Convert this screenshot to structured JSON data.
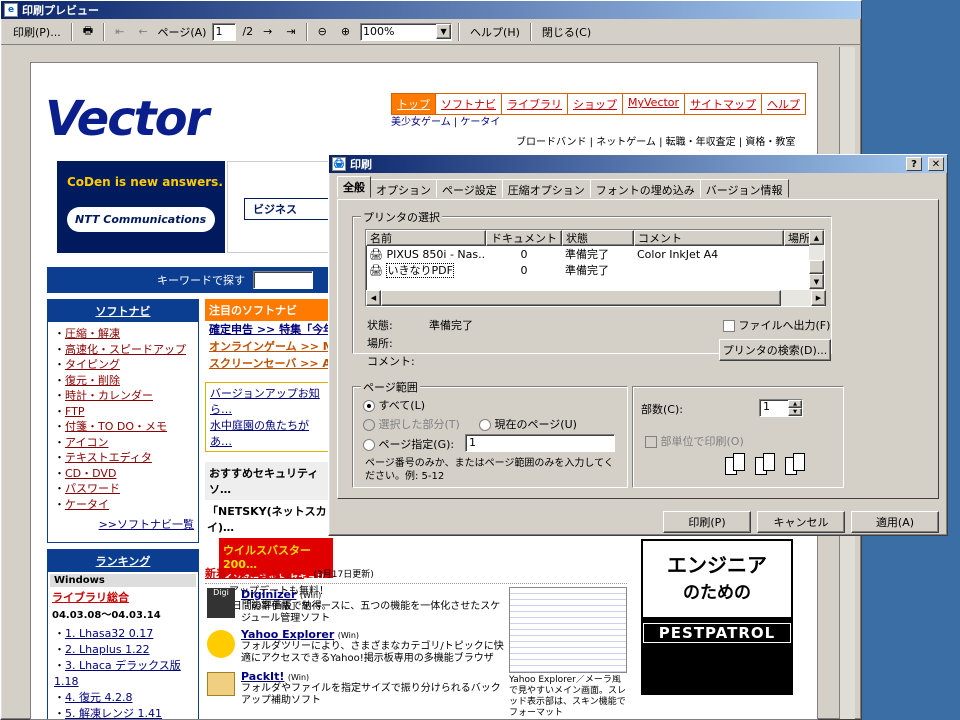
{
  "preview": {
    "title": "印刷プレビュー",
    "toolbar": {
      "print": "印刷(P)...",
      "page_label": "ページ(A)",
      "page_value": "1",
      "page_total": "/2",
      "zoom": "100%",
      "help": "ヘルプ(H)",
      "close": "閉じる(C)"
    }
  },
  "site": {
    "logo": "Vector",
    "nav": [
      "トップ",
      "ソフトナビ",
      "ライブラリ",
      "ショップ",
      "MyVector",
      "サイトマップ",
      "ヘルプ"
    ],
    "subnav": "美少女ゲーム | ケータイ",
    "subnav2": "ブロードバンド | ネットゲーム | 転職・年収査定 | 資格・教室",
    "banner_line1": "CoDen is new answers.",
    "banner_line2": "NTT Communications",
    "biz": "ビジネス",
    "search_label": "キーワードで探す",
    "softnavi": {
      "header": "ソフトナビ",
      "items": [
        "圧縮・解凍",
        "高速化・スピードアップ",
        "タイピング",
        "復元・削除",
        "時計・カレンダー",
        "FTP",
        "付箋・TO DO・メモ",
        "アイコン",
        "テキストエディタ",
        "CD・DVD",
        "パスワード",
        "ケータイ"
      ],
      "more": ">>ソフトナビ一覧"
    },
    "ranking": {
      "header": "ランキング",
      "os": "Windows",
      "cat": "ライブラリ総合",
      "period": "04.03.08～04.03.14",
      "items": [
        "1. Lhasa32 0.17",
        "2. Lhaplus 1.22",
        "3. Lhaca デラックス版 1.18",
        "4. 復元 4.2.8",
        "5. 解凍レンジ 1.41"
      ]
    },
    "featured": {
      "header": "注目のソフトナビ",
      "rows": [
        "確定申告 >> 特集「今年…",
        "オンラインゲーム >> Mic…",
        "スクリーンセーバ >> AQ…"
      ],
      "notice1": "バージョンアップお知ら…",
      "notice2": "水中庭園の魚たちがあ…",
      "security": "おすすめセキュリティソ…",
      "netsky": "「NETSKY(ネットスカイ)…",
      "virus": "ウイルスバスター 200…",
      "virus_sub": "インターネット セキュリティ",
      "update": "アップデートも無料！",
      "trial": "30日間の評価版で納得。"
    },
    "reviews": {
      "header": "新着ソフトレビュー",
      "date": "(3月17日更新)",
      "items": [
        {
          "name": "Diginizer",
          "os": "(Win)",
          "desc": "「能率手帳」をベースに、五つの機能を一体化させたスケジュール管理ソフト"
        },
        {
          "name": "Yahoo Explorer",
          "os": "(Win)",
          "desc": "フォルダツリーにより、さまざまなカテゴリ/トピックに快適にアクセスできるYahoo!掲示板専用の多機能ブラウザ"
        },
        {
          "name": "PackIt!",
          "os": "(Win)",
          "desc": "フォルダやファイルを指定サイズで振り分けられるバックアップ補助ソフト"
        }
      ],
      "caption": "Yahoo Explorer／メーラ風で見やすいメイン画面。スレッド表示部は、スキン機能でフォーマット"
    },
    "ad1a": "エンジニア",
    "ad1b": "のための",
    "ad2": "PESTPATROL"
  },
  "print_dialog": {
    "title": "印刷",
    "tabs": [
      "全般",
      "オプション",
      "ページ設定",
      "圧縮オプション",
      "フォントの埋め込み",
      "バージョン情報"
    ],
    "printer_group": "プリンタの選択",
    "columns": [
      "名前",
      "ドキュメント",
      "状態",
      "コメント",
      "場所"
    ],
    "printers": [
      {
        "name": "PIXUS 850i - Nas...",
        "docs": "0",
        "status": "準備完了",
        "comment": "Color InkJet A4"
      },
      {
        "name": "いきなりPDF",
        "docs": "0",
        "status": "準備完了",
        "comment": ""
      }
    ],
    "status_label": "状態:",
    "status_value": "準備完了",
    "location_label": "場所:",
    "comment_label": "コメント:",
    "print_to_file": "ファイルへ出力(F)",
    "find_printer": "プリンタの検索(D)...",
    "range_group": "ページ範囲",
    "all": "すべて(L)",
    "selection": "選択した部分(T)",
    "current": "現在のページ(U)",
    "pages": "ページ指定(G):",
    "pages_value": "1",
    "range_help": "ページ番号のみか、またはページ範囲のみを入力してください。例: 5-12",
    "copies_label": "部数(C):",
    "copies_value": "1",
    "collate": "部単位で印刷(O)",
    "ok": "印刷(P)",
    "cancel": "キャンセル",
    "apply": "適用(A)"
  }
}
